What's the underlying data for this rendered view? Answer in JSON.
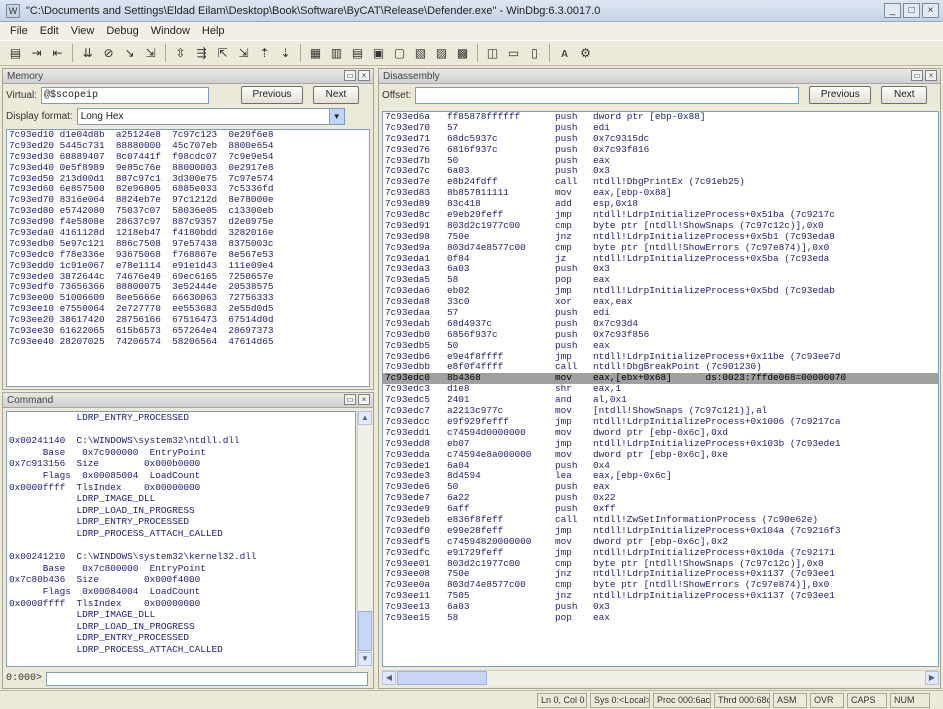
{
  "window": {
    "title": "\"C:\\Documents and Settings\\Eldad Eilam\\Desktop\\Book\\Software\\ByCAT\\Release\\Defender.exe\" - WinDbg:6.3.0017.0",
    "icon_glyph": "W",
    "controls": [
      "_",
      "□",
      "×"
    ]
  },
  "menu": [
    "File",
    "Edit",
    "View",
    "Debug",
    "Window",
    "Help"
  ],
  "toolbar": {
    "buttons": [
      "▤",
      "⇥",
      "⇤",
      "⇊",
      "⊘",
      "↘",
      "⇲",
      "⇳",
      "⇶",
      "⇱",
      "⇲",
      "⇡",
      "⇣",
      "▦",
      "▥",
      "▤",
      "▣",
      "▢",
      "▧",
      "▨",
      "▩",
      "◫",
      "▭",
      "▯",
      "ᴀ",
      "⚙"
    ]
  },
  "memory": {
    "title": "Memory",
    "virtual_label": "Virtual:",
    "virtual_value": "@$scopeip",
    "previous_label": "Previous",
    "next_label": "Next",
    "display_format_label": "Display format:",
    "display_format_value": "Long Hex",
    "rows": [
      {
        "addr": "7c93ed10",
        "vals": "d1e04d8b  a25124e8  7c97c123  0e29f6e8"
      },
      {
        "addr": "7c93ed20",
        "vals": "5445c731  88880000  45c707eb  8800e654"
      },
      {
        "addr": "7c93ed30",
        "vals": "68889407  8c07441f  f98cdc07  7c9e9e54"
      },
      {
        "addr": "7c93ed40",
        "vals": "0e5f8989  9e85c76e  88000003  0e2917e8"
      },
      {
        "addr": "7c93ed50",
        "vals": "213d00d1  887c97c1  3d300e75  7c97e574"
      },
      {
        "addr": "7c93ed60",
        "vals": "6e857500  82e96805  6885e033  7c5336fd"
      },
      {
        "addr": "7c93ed70",
        "vals": "8316e064  8824eb7e  97c1212d  8e78000e"
      },
      {
        "addr": "7c93ed80",
        "vals": "e5742080  75037c07  58036e05  c13300eb"
      },
      {
        "addr": "7c93ed90",
        "vals": "f4e5808e  28637c97  887c9357  d2e0975e"
      },
      {
        "addr": "7c93eda0",
        "vals": "4161128d  1218eb47  f4180bdd  3282016e"
      },
      {
        "addr": "7c93edb0",
        "vals": "5e97c121  886c7508  97e57438  8375003c"
      },
      {
        "addr": "7c93edc0",
        "vals": "f78e336e  93675068  f768867e  8e567e53"
      },
      {
        "addr": "7c93edd0",
        "vals": "1c91e067  e78e1114  e91e1d43  111e09e4"
      },
      {
        "addr": "7c93ede0",
        "vals": "3872644c  74676e49  69ec6165  7250657e"
      },
      {
        "addr": "7c93edf0",
        "vals": "73656366  88800075  3e52444e  20538575"
      },
      {
        "addr": "7c93ee00",
        "vals": "51006600  8ee5666e  66630063  72756333"
      },
      {
        "addr": "7c93ee10",
        "vals": "e7550064  2e727770  ee553683  2e55d0d5"
      },
      {
        "addr": "7c93ee20",
        "vals": "38617420  28756166  67516473  67514d0d"
      },
      {
        "addr": "7c93ee30",
        "vals": "61622065  615b6573  657264e4  28697373"
      },
      {
        "addr": "7c93ee40",
        "vals": "28207025  74206574  58206564  47614d65"
      }
    ]
  },
  "command": {
    "title": "Command",
    "lines": [
      "            LDRP_ENTRY_PROCESSED",
      "",
      "0x00241140  C:\\WINDOWS\\system32\\ntdll.dll",
      "      Base   0x7c900000  EntryPoint",
      "0x7c913156  Size        0x000b0000",
      "      Flags  0x00085004  LoadCount",
      "0x0000ffff  TlsIndex    0x00000000",
      "            LDRP_IMAGE_DLL",
      "            LDRP_LOAD_IN_PROGRESS",
      "            LDRP_ENTRY_PROCESSED",
      "            LDRP_PROCESS_ATTACH_CALLED",
      "",
      "0x00241210  C:\\WINDOWS\\system32\\kernel32.dll",
      "      Base   0x7c800000  EntryPoint",
      "0x7c80b436  Size        0x000f4000",
      "      Flags  0x00084004  LoadCount",
      "0x0000ffff  TlsIndex    0x00000000",
      "            LDRP_IMAGE_DLL",
      "            LDRP_LOAD_IN_PROGRESS",
      "            LDRP_ENTRY_PROCESSED",
      "            LDRP_PROCESS_ATTACH_CALLED"
    ],
    "prompt": "0:000>"
  },
  "disassembly": {
    "title": "Disassembly",
    "offset_label": "Offset:",
    "offset_value": "",
    "previous_label": "Previous",
    "next_label": "Next",
    "rows": [
      {
        "addr": "7c93ed6a",
        "bytes": "ff85878ffffff",
        "op": "push",
        "args": "dword ptr [ebp-0x88]"
      },
      {
        "addr": "7c93ed70",
        "bytes": "57",
        "op": "push",
        "args": "edi"
      },
      {
        "addr": "7c93ed71",
        "bytes": "68dc5937c",
        "op": "push",
        "args": "0x7c9315dc"
      },
      {
        "addr": "7c93ed76",
        "bytes": "6816f937c",
        "op": "push",
        "args": "0x7c93f816"
      },
      {
        "addr": "7c93ed7b",
        "bytes": "50",
        "op": "push",
        "args": "eax"
      },
      {
        "addr": "7c93ed7c",
        "bytes": "6a03",
        "op": "push",
        "args": "0x3"
      },
      {
        "addr": "7c93ed7e",
        "bytes": "e8b24fdff",
        "op": "call",
        "args": "ntdll!DbgPrintEx (7c91eb25)"
      },
      {
        "addr": "7c93ed83",
        "bytes": "8b857811111",
        "op": "mov",
        "args": "eax,[ebp-0x88]"
      },
      {
        "addr": "7c93ed89",
        "bytes": "83c418",
        "op": "add",
        "args": "esp,0x18"
      },
      {
        "addr": "7c93ed8c",
        "bytes": "e9eb29feff",
        "op": "jmp",
        "args": "ntdll!LdrpInitializeProcess+0x51ba (7c9217c"
      },
      {
        "addr": "7c93ed91",
        "bytes": "803d2c1977c00",
        "op": "cmp",
        "args": "byte ptr [ntdll!ShowSnaps (7c97c12c)],0x0"
      },
      {
        "addr": "7c93ed98",
        "bytes": "750e",
        "op": "jnz",
        "args": "ntdll!LdrpInitializeProcess+0x5b1 (7c93eda8"
      },
      {
        "addr": "7c93ed9a",
        "bytes": "803d74e8577c00",
        "op": "cmp",
        "args": "byte ptr [ntdll!ShowErrors (7c97e874)],0x0"
      },
      {
        "addr": "7c93eda1",
        "bytes": "0f84",
        "op": "jz",
        "args": "ntdll!LdrpInitializeProcess+0x5ba (7c93eda"
      },
      {
        "addr": "7c93eda3",
        "bytes": "6a03",
        "op": "push",
        "args": "0x3"
      },
      {
        "addr": "7c93eda5",
        "bytes": "58",
        "op": "pop",
        "args": "eax"
      },
      {
        "addr": "7c93eda6",
        "bytes": "eb02",
        "op": "jmp",
        "args": "ntdll!LdrpInitializeProcess+0x5bd (7c93edab"
      },
      {
        "addr": "7c93eda8",
        "bytes": "33c0",
        "op": "xor",
        "args": "eax,eax"
      },
      {
        "addr": "7c93edaa",
        "bytes": "57",
        "op": "push",
        "args": "edi"
      },
      {
        "addr": "7c93edab",
        "bytes": "68d4937c",
        "op": "push",
        "args": "0x7c93d4"
      },
      {
        "addr": "7c93edb0",
        "bytes": "6856f937c",
        "op": "push",
        "args": "0x7c93f856"
      },
      {
        "addr": "7c93edb5",
        "bytes": "50",
        "op": "push",
        "args": "eax"
      },
      {
        "addr": "7c93edb6",
        "bytes": "e9e4f8ffff",
        "op": "jmp",
        "args": "ntdll!LdrpInitializeProcess+0x11be (7c93ee7d"
      },
      {
        "addr": "7c93edbb",
        "bytes": "e8f0f4ffff",
        "op": "call",
        "args": "ntdll!DbgBreakPoint (7c901230)"
      },
      {
        "addr": "7c93edc0",
        "bytes": "8b4368",
        "op": "mov",
        "args": "eax,[ebx+0x68]      ds:0023:7ffde068=00000070"
      },
      {
        "addr": "7c93edc3",
        "bytes": "d1e8",
        "op": "shr",
        "args": "eax,1"
      },
      {
        "addr": "7c93edc5",
        "bytes": "2401",
        "op": "and",
        "args": "al,0x1"
      },
      {
        "addr": "7c93edc7",
        "bytes": "a2213c977c",
        "op": "mov",
        "args": "[ntdll!ShowSnaps (7c97c121)],al"
      },
      {
        "addr": "7c93edcc",
        "bytes": "e9f929fefff",
        "op": "jmp",
        "args": "ntdll!LdrpInitializeProcess+0x1006 (7c9217ca"
      },
      {
        "addr": "7c93edd1",
        "bytes": "c74594d0000000",
        "op": "mov",
        "args": "dword ptr [ebp-0x6c],0xd"
      },
      {
        "addr": "7c93edd8",
        "bytes": "eb07",
        "op": "jmp",
        "args": "ntdll!LdrpInitializeProcess+0x103b (7c93ede1"
      },
      {
        "addr": "7c93edda",
        "bytes": "c74594e8a000000",
        "op": "mov",
        "args": "dword ptr [ebp-0x6c],0xe"
      },
      {
        "addr": "7c93ede1",
        "bytes": "6a04",
        "op": "push",
        "args": "0x4"
      },
      {
        "addr": "7c93ede3",
        "bytes": "8d4594",
        "op": "lea",
        "args": "eax,[ebp-0x6c]"
      },
      {
        "addr": "7c93ede6",
        "bytes": "50",
        "op": "push",
        "args": "eax"
      },
      {
        "addr": "7c93ede7",
        "bytes": "6a22",
        "op": "push",
        "args": "0x22"
      },
      {
        "addr": "7c93ede9",
        "bytes": "6aff",
        "op": "push",
        "args": "0xff"
      },
      {
        "addr": "7c93edeb",
        "bytes": "e836f8feff",
        "op": "call",
        "args": "ntdll!ZwSetInformationProcess (7c90e62e)"
      },
      {
        "addr": "7c93edf0",
        "bytes": "e99e28feff",
        "op": "jmp",
        "args": "ntdll!LdrpInitializeProcess+0x104a (7c9216f3"
      },
      {
        "addr": "7c93edf5",
        "bytes": "c74594820000000",
        "op": "mov",
        "args": "dword ptr [ebp-0x6c],0x2"
      },
      {
        "addr": "7c93edfc",
        "bytes": "e91729feff",
        "op": "jmp",
        "args": "ntdll!LdrpInitializeProcess+0x10da (7c92171"
      },
      {
        "addr": "7c93ee01",
        "bytes": "803d2c1977c00",
        "op": "cmp",
        "args": "byte ptr [ntdll!ShowSnaps (7c97c12c)],0x0"
      },
      {
        "addr": "7c93ee08",
        "bytes": "750e",
        "op": "jnz",
        "args": "ntdll!LdrpInitializeProcess+0x1137 (7c93ee1"
      },
      {
        "addr": "7c93ee0a",
        "bytes": "803d74e8577c00",
        "op": "cmp",
        "args": "byte ptr [ntdll!ShowErrors (7c97e874)],0x0"
      },
      {
        "addr": "7c93ee11",
        "bytes": "7505",
        "op": "jnz",
        "args": "ntdll!LdrpInitializeProcess+0x1137 (7c93ee1"
      },
      {
        "addr": "7c93ee13",
        "bytes": "6a03",
        "op": "push",
        "args": "0x3"
      },
      {
        "addr": "7c93ee15",
        "bytes": "58",
        "op": "pop",
        "args": "eax"
      }
    ],
    "highlight_index": 24
  },
  "status": {
    "cells": [
      "Ln 0, Col 0",
      "Sys 0:<Local>",
      "Proc 000:6ac",
      "Thrd 000:68c",
      "ASM",
      "OVR",
      "CAPS",
      "NUM"
    ]
  }
}
